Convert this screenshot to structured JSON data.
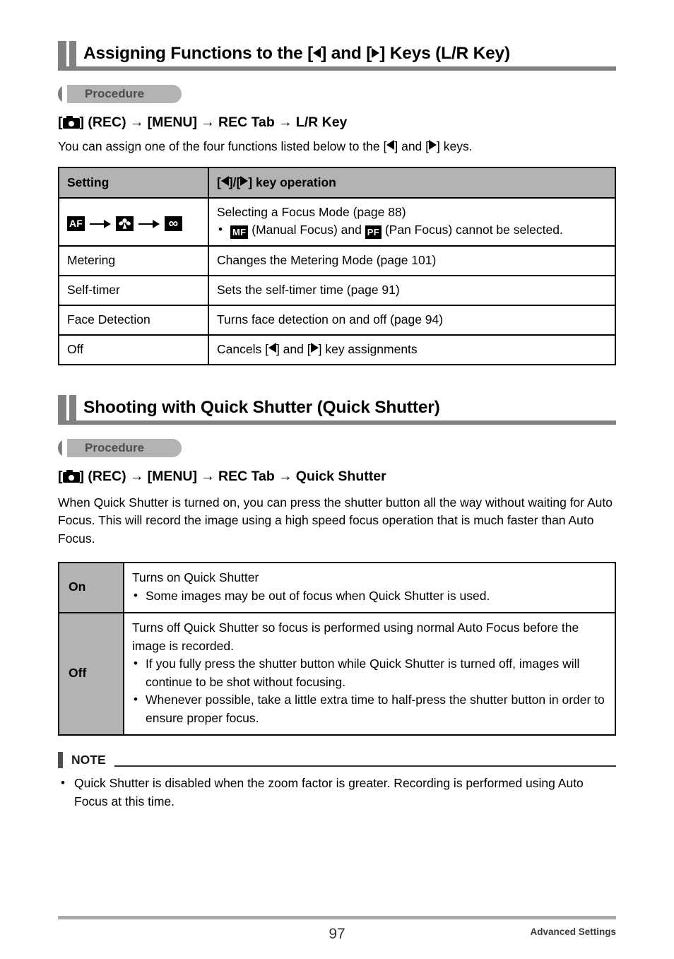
{
  "page": {
    "number": "97",
    "footer_section": "Advanced Settings"
  },
  "sections": [
    {
      "heading": "Assigning Functions to the [◀] and [▶] Keys (L/R Key)",
      "heading_parts": {
        "before": "Assigning Functions to the [",
        "middle": "] and [",
        "after": "] Keys (L/R Key)"
      },
      "procedure_label": "Procedure",
      "path": {
        "bracket_open": "[",
        "bracket_close": "] (REC)",
        "arrow": "→",
        "step2": "[MENU]",
        "step3": "REC Tab",
        "step4": "L/R Key"
      },
      "intro_parts": {
        "a": "You can assign one of the four functions listed below to the [",
        "b": "] and [",
        "c": "] keys."
      },
      "table": {
        "headers": {
          "col1": "Setting",
          "col2_a": "[",
          "col2_b": "]/[",
          "col2_c": "] key operation"
        },
        "rows": [
          {
            "setting_type": "icons",
            "icons": [
              "AF",
              "macro",
              "∞"
            ],
            "desc_main": "Selecting a Focus Mode (page 88)",
            "bullets_rich": {
              "badge1": "MF",
              "text1": "(Manual Focus) and",
              "badge2": "PF",
              "text2": "(Pan Focus) cannot be selected."
            }
          },
          {
            "setting_type": "text",
            "setting": "Metering",
            "desc_main": "Changes the Metering Mode (page 101)"
          },
          {
            "setting_type": "text",
            "setting": "Self-timer",
            "desc_main": "Sets the self-timer time (page 91)"
          },
          {
            "setting_type": "text",
            "setting": "Face Detection",
            "desc_main": "Turns face detection on and off (page 94)"
          },
          {
            "setting_type": "text",
            "setting": "Off",
            "desc_rich": {
              "a": "Cancels [",
              "b": "] and [",
              "c": "] key assignments"
            }
          }
        ]
      }
    },
    {
      "heading": "Shooting with Quick Shutter (Quick Shutter)",
      "procedure_label": "Procedure",
      "path": {
        "bracket_open": "[",
        "bracket_close": "] (REC)",
        "arrow": "→",
        "step2": "[MENU]",
        "step3": "REC Tab",
        "step4": "Quick Shutter"
      },
      "paragraph": "When Quick Shutter is turned on, you can press the shutter button all the way without waiting for Auto Focus. This will record the image using a high speed focus operation that is much faster than Auto Focus.",
      "table": {
        "rows": [
          {
            "key": "On",
            "main": "Turns on Quick Shutter",
            "bullets": [
              "Some images may be out of focus when Quick Shutter is used."
            ]
          },
          {
            "key": "Off",
            "main": "Turns off Quick Shutter so focus is performed using normal Auto Focus before the image is recorded.",
            "bullets": [
              "If you fully press the shutter button while Quick Shutter is turned off, images will continue to be shot without focusing.",
              "Whenever possible, take a little extra time to half-press the shutter button in order to ensure proper focus."
            ]
          }
        ]
      },
      "note": {
        "label": "NOTE",
        "bullets": [
          "Quick Shutter is disabled when the zoom factor is greater. Recording is performed using Auto Focus at this time."
        ]
      }
    }
  ],
  "colors": {
    "heading_bar": "#808080",
    "table_header_gray": "#b3b3b3",
    "note_bar": "#4d4d4d",
    "footer_rule": "#aaaaaa"
  },
  "icons": {
    "camera": "camera-icon",
    "left_triangle": "left-arrow-key-icon",
    "right_triangle": "right-arrow-key-icon",
    "af": "af-badge-icon",
    "macro": "macro-flower-icon",
    "infinity": "infinity-focus-icon",
    "mf": "mf-badge-icon",
    "pf": "pf-badge-icon"
  }
}
